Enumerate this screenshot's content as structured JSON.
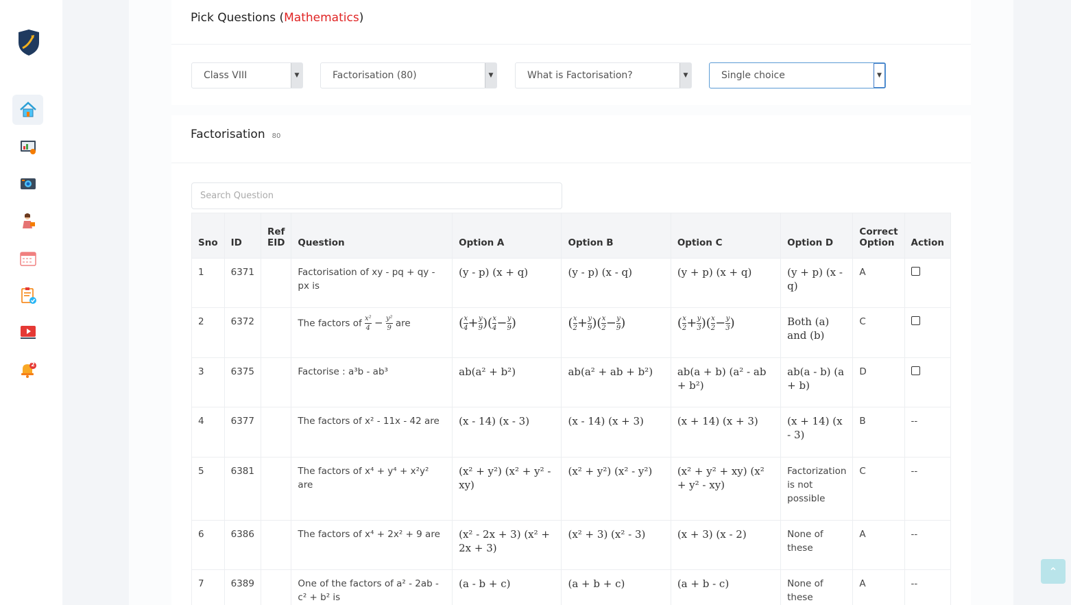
{
  "header": {
    "title_prefix": "Pick Questions (",
    "subject": "Mathematics",
    "title_suffix": ")"
  },
  "filters": {
    "class": "Class VIII",
    "chapter": "Factorisation (80)",
    "topic": "What is Factorisation?",
    "type": "Single choice"
  },
  "section": {
    "title": "Factorisation",
    "count": "80"
  },
  "search": {
    "placeholder": "Search Question"
  },
  "table": {
    "headers": {
      "sno": "Sno",
      "id": "ID",
      "ref": "Ref EID",
      "question": "Question",
      "a": "Option A",
      "b": "Option B",
      "c": "Option C",
      "d": "Option D",
      "correct": "Correct Option",
      "action": "Action"
    },
    "rows": [
      {
        "sno": "1",
        "id": "6371",
        "ref": "",
        "question": "Factorisation of xy - pq + qy - px is",
        "a": "(y - p) (x + q)",
        "b": "(y - p) (x - q)",
        "c": "(y + p) (x + q)",
        "d": "(y + p) (x - q)",
        "correct": "A",
        "action": "checkbox"
      },
      {
        "sno": "2",
        "id": "6372",
        "ref": "",
        "question": "The factors of",
        "question_end": "are",
        "a": "",
        "b": "",
        "c": "",
        "d": "Both (a) and (b)",
        "correct": "C",
        "action": "checkbox"
      },
      {
        "sno": "3",
        "id": "6375",
        "ref": "",
        "question": "Factorise : a³b - ab³",
        "a": "ab(a² + b²)",
        "b": "ab(a² + ab + b²)",
        "c": "ab(a + b) (a² - ab + b²)",
        "d": "ab(a - b) (a + b)",
        "correct": "D",
        "action": "checkbox"
      },
      {
        "sno": "4",
        "id": "6377",
        "ref": "",
        "question": "The factors of x² - 11x - 42 are",
        "a": "(x - 14) (x - 3)",
        "b": "(x - 14) (x + 3)",
        "c": "(x + 14) (x + 3)",
        "d": "(x + 14) (x - 3)",
        "correct": "B",
        "action": "--"
      },
      {
        "sno": "5",
        "id": "6381",
        "ref": "",
        "question": "The factors of x⁴ + y⁴ + x²y² are",
        "a": "(x² + y²) (x² + y² - xy)",
        "b": "(x² + y²) (x² - y²)",
        "c": "(x² + y² + xy) (x² + y² - xy)",
        "d": "Factorization is not possible",
        "correct": "C",
        "action": "--"
      },
      {
        "sno": "6",
        "id": "6386",
        "ref": "",
        "question": "The factors of x⁴ + 2x² + 9 are",
        "a": "(x² - 2x + 3) (x² + 2x + 3)",
        "b": "(x² + 3) (x² - 3)",
        "c": "(x + 3) (x - 2)",
        "d": "None of these",
        "correct": "A",
        "action": "--"
      },
      {
        "sno": "7",
        "id": "6389",
        "ref": "",
        "question": "One of the factors of a² - 2ab - c² + b² is",
        "a": "(a - b + c)",
        "b": "(a + b + c)",
        "c": "(a + b - c)",
        "d": "None of these",
        "correct": "A",
        "action": "--"
      }
    ]
  },
  "sidebar": {
    "items": [
      "home-icon",
      "reports-icon",
      "photo-gallery-icon",
      "teacher-icon",
      "calendar-icon",
      "checklist-icon",
      "video-icon",
      "notification-bell-icon"
    ],
    "notification_count": "2"
  },
  "colors": {
    "accent": "#e02424",
    "focus": "#3b78c6"
  }
}
